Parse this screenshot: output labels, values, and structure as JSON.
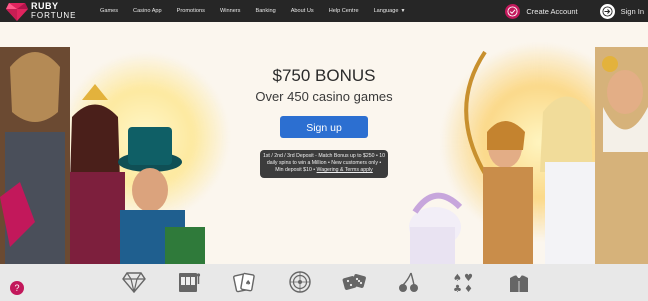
{
  "logo": {
    "line1": "RUBY",
    "line2": "FORTUNE"
  },
  "nav": {
    "items": [
      "Games",
      "Casino App",
      "Promotions",
      "Winners",
      "Banking",
      "About Us",
      "Help Centre",
      "Language"
    ]
  },
  "account": {
    "create": "Create Account",
    "signin": "Sign In"
  },
  "hero": {
    "bonus": "$750 BONUS",
    "games": "Over 450 casino games",
    "signup": "Sign up",
    "terms_text": "1st / 2nd / 3rd Deposit - Match Bonus up to $250 • 10 daily spins to win a Million • New customers only • Min deposit $10 •",
    "terms_link": "Wagering & Terms apply"
  },
  "categories": [
    "diamond-icon",
    "slot-machine-icon",
    "cards-icon",
    "roulette-icon",
    "dice-icon",
    "cherries-icon",
    "card-suits-icon",
    "dealer-icon"
  ],
  "help": {
    "label": "?"
  },
  "colors": {
    "topbar": "#262626",
    "brand": "#c2185b",
    "signup": "#2c6fd1",
    "bottombar": "#e8e8e8"
  }
}
